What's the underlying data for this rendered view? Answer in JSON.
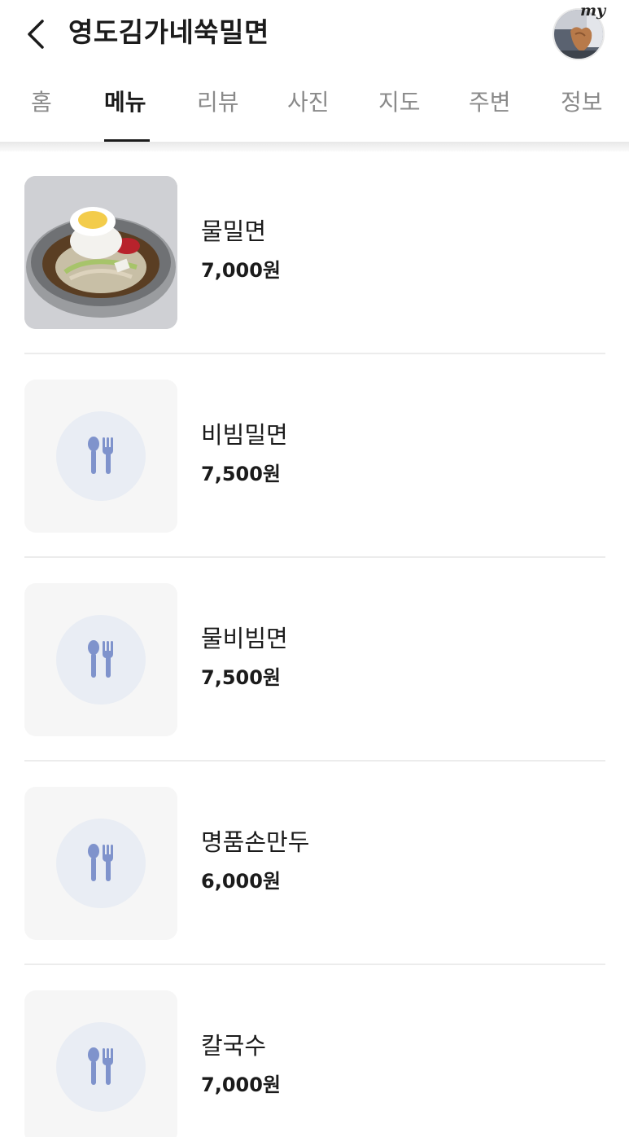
{
  "header": {
    "title": "영도김가네쑥밀면",
    "back_icon": "chevron-left-icon",
    "my_label": "my"
  },
  "tabs": [
    {
      "label": "홈",
      "active": false
    },
    {
      "label": "메뉴",
      "active": true
    },
    {
      "label": "리뷰",
      "active": false
    },
    {
      "label": "사진",
      "active": false
    },
    {
      "label": "지도",
      "active": false
    },
    {
      "label": "주변",
      "active": false
    },
    {
      "label": "정보",
      "active": false
    }
  ],
  "menu": {
    "items": [
      {
        "name": "물밀면",
        "price": "7,000원",
        "image": "naengmyeon-photo"
      },
      {
        "name": "비빔밀면",
        "price": "7,500원",
        "image": "utensils-placeholder-icon"
      },
      {
        "name": "물비빔면",
        "price": "7,500원",
        "image": "utensils-placeholder-icon"
      },
      {
        "name": "명품손만두",
        "price": "6,000원",
        "image": "utensils-placeholder-icon"
      },
      {
        "name": "칼국수",
        "price": "7,000원",
        "image": "utensils-placeholder-icon"
      }
    ]
  },
  "colors": {
    "text": "#1b1b1b",
    "inactive_tab": "#8a8a8a",
    "placeholder_bg": "#f6f6f6",
    "placeholder_circle": "#e9edf4",
    "utensil": "#7f93cc"
  }
}
